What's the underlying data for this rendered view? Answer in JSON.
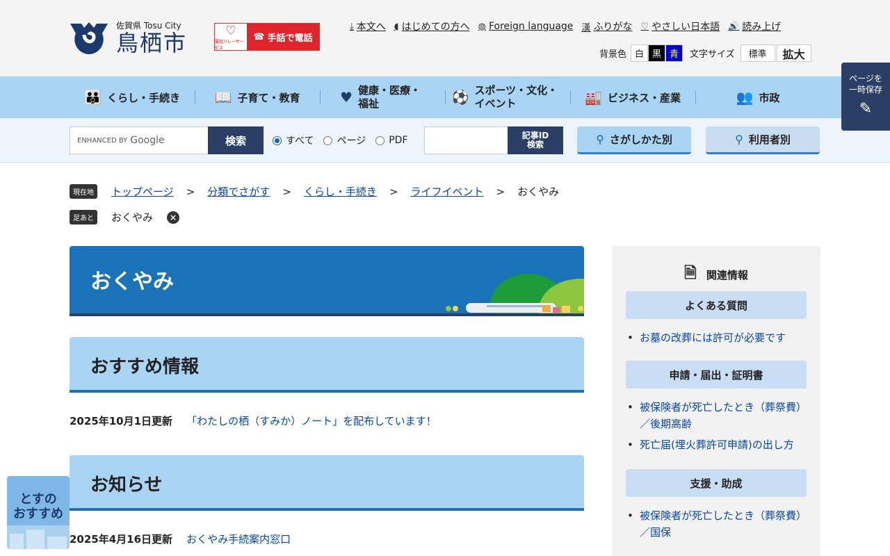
{
  "header": {
    "city_sub": "佐賀県 Tosu City",
    "city_name": "鳥栖市",
    "sign_left": "電話リレーサービス",
    "sign_label": "手話で電話",
    "top_links": [
      {
        "label": "本文へ",
        "icon": "download-icon"
      },
      {
        "label": "はじめての方へ",
        "icon": "leaf-icon"
      },
      {
        "label": "Foreign language",
        "icon": "globe-icon"
      },
      {
        "label": "ふりがな",
        "icon": "furigana-icon"
      },
      {
        "label": "やさしい日本語",
        "icon": "heart-icon"
      },
      {
        "label": "読み上げ",
        "icon": "speaker-icon"
      }
    ],
    "bg_label": "背景色",
    "bg_white": "白",
    "bg_black": "黒",
    "bg_blue": "青",
    "font_label": "文字サイズ",
    "font_normal": "標準",
    "font_large": "拡大"
  },
  "nav": [
    {
      "label": "くらし・手続き",
      "icon": "family-icon"
    },
    {
      "label": "子育て・教育",
      "icon": "book-icon"
    },
    {
      "label": "健康・医療・福祉",
      "icon": "heart-icon"
    },
    {
      "label": "スポーツ・文化・イベント",
      "icon": "ball-icon"
    },
    {
      "label": "ビジネス・産業",
      "icon": "factory-icon"
    },
    {
      "label": "市政",
      "icon": "people-icon"
    }
  ],
  "search": {
    "google_prefix": "ENHANCED BY",
    "google_brand": "Google",
    "button": "検索",
    "radio_all": "すべて",
    "radio_page": "ページ",
    "radio_pdf": "PDF",
    "id_btn_1": "記事ID",
    "id_btn_2": "検索",
    "find_by_method": "さがしかた別",
    "find_by_user": "利用者別"
  },
  "save_tab": {
    "line1": "ページを",
    "line2": "一時保存"
  },
  "recommend_tab": {
    "line1": "とすの",
    "line2": "おすすめ"
  },
  "breadcrumb": {
    "tag": "現在地",
    "items": [
      "トップページ",
      "分類でさがす",
      "くらし・手続き",
      "ライフイベント"
    ],
    "current": "おくやみ",
    "sep": ">"
  },
  "footprints": {
    "tag": "足あと",
    "item": "おくやみ",
    "close": "×"
  },
  "page_title": "おくやみ",
  "sections": {
    "recommend": {
      "title": "おすすめ情報",
      "date": "2025年10月1日更新",
      "link": "「わたしの栖（すみか）ノート」を配布しています！"
    },
    "notice": {
      "title": "お知らせ",
      "date": "2025年4月16日更新",
      "link": "おくやみ手続案内窓口"
    }
  },
  "related": {
    "title": "関連情報",
    "cats": [
      {
        "label": "よくある質問",
        "links": [
          "お墓の改葬には許可が必要です"
        ]
      },
      {
        "label": "申請・届出・証明書",
        "links": [
          "被保険者が死亡したとき（葬祭費）／後期高齢",
          "死亡届(埋火葬許可申請)の出し方"
        ]
      },
      {
        "label": "支援・助成",
        "links": [
          "被保険者が死亡したとき（葬祭費）／国保"
        ]
      }
    ]
  }
}
